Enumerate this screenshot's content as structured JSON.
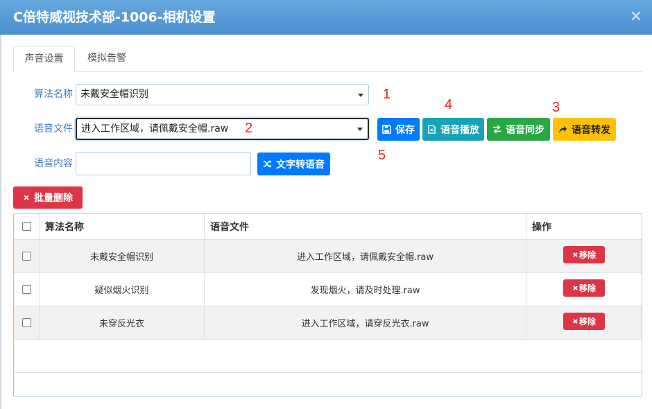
{
  "window": {
    "title": "C倍特威视技术部-1006-相机设置",
    "close_label": "×"
  },
  "tabs": [
    {
      "label": "声音设置",
      "active": true
    },
    {
      "label": "模拟告警",
      "active": false
    }
  ],
  "form": {
    "algorithm": {
      "label": "算法名称",
      "value": "未戴安全帽识别"
    },
    "voice_file": {
      "label": "语音文件",
      "value": "进入工作区域，请佩戴安全帽.raw"
    },
    "voice_content": {
      "label": "语音内容"
    },
    "buttons": {
      "save": "保存",
      "play": "语音播放",
      "sync": "语音同步",
      "forward": "语音转发",
      "tts": "文字转语音"
    }
  },
  "batch_delete_label": "批量删除",
  "table": {
    "headers": {
      "algorithm": "算法名称",
      "file": "语音文件",
      "action": "操作"
    },
    "rows": [
      {
        "algorithm": "未戴安全帽识别",
        "file": "进入工作区域，请佩戴安全帽.raw",
        "action": "移除"
      },
      {
        "algorithm": "疑似烟火识别",
        "file": "发现烟火，请及时处理.raw",
        "action": "移除"
      },
      {
        "algorithm": "未穿反光衣",
        "file": "进入工作区域，请穿反光衣.raw",
        "action": "移除"
      }
    ]
  },
  "annotations": {
    "a1": "1",
    "a2": "2",
    "a3": "3",
    "a4": "4",
    "a5": "5"
  },
  "colors": {
    "primary": "#007bff",
    "info": "#17a2b8",
    "success": "#28a745",
    "warning": "#ffc107",
    "danger": "#dc3545",
    "annotation": "#e8221c"
  },
  "icons": {
    "save": "floppy-icon",
    "play": "file-audio-icon",
    "sync": "exchange-icon",
    "forward": "share-icon",
    "tts": "random-icon",
    "delete": "times-icon",
    "close": "close-icon"
  }
}
